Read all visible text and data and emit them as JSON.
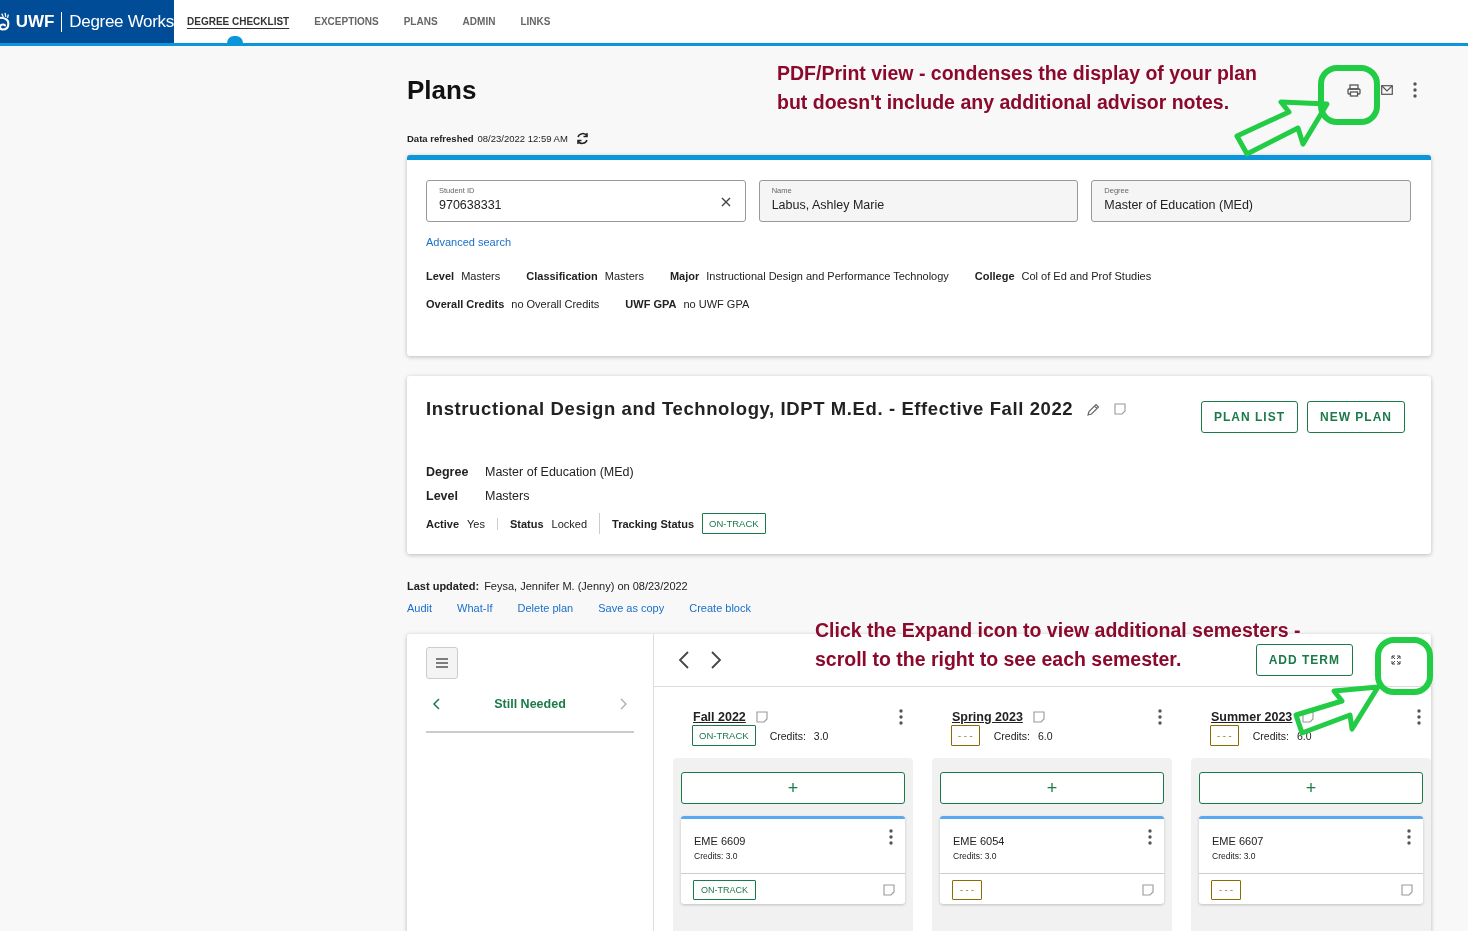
{
  "header": {
    "logo_short": "UWF",
    "logo_name": "Degree Works",
    "tabs": [
      {
        "label": "DEGREE CHECKLIST",
        "selected": true
      },
      {
        "label": "EXCEPTIONS",
        "selected": false
      },
      {
        "label": "PLANS",
        "selected": false
      },
      {
        "label": "ADMIN",
        "selected": false
      },
      {
        "label": "LINKS",
        "selected": false
      }
    ]
  },
  "page_title": "Plans",
  "refresh": {
    "label": "Data refreshed",
    "value": "08/23/2022 12:59 AM"
  },
  "annotations": [
    {
      "lines": [
        "PDF/Print view - condenses the display of your plan",
        "but doesn't include any additional advisor notes."
      ]
    },
    {
      "lines": [
        "Click the Expand icon to view additional semesters -",
        "scroll to the right to see each semester."
      ]
    }
  ],
  "student": {
    "fields": [
      {
        "label": "Student ID",
        "value": "970638331",
        "kind": "editable"
      },
      {
        "label": "Name",
        "value": "Labus, Ashley Marie",
        "kind": "readonly"
      },
      {
        "label": "Degree",
        "value": "Master of Education (MEd)",
        "kind": "readonly"
      }
    ],
    "advanced_search": "Advanced search",
    "facts": [
      [
        {
          "label": "Level",
          "value": "Masters"
        },
        {
          "label": "Classification",
          "value": "Masters"
        },
        {
          "label": "Major",
          "value": "Instructional Design and Performance Technology"
        },
        {
          "label": "College",
          "value": "Col of Ed and Prof Studies"
        }
      ],
      [
        {
          "label": "Overall Credits",
          "value": "no Overall Credits"
        },
        {
          "label": "UWF GPA",
          "value": "no UWF GPA"
        }
      ]
    ]
  },
  "plan": {
    "title": "Instructional Design and Technology, IDPT M.Ed. - Effective Fall 2022",
    "buttons": [
      "PLAN LIST",
      "NEW PLAN"
    ],
    "details": [
      {
        "label": "Degree",
        "value": "Master of Education (MEd)"
      },
      {
        "label": "Level",
        "value": "Masters"
      }
    ],
    "statuses": [
      {
        "label": "Active",
        "value": "Yes",
        "kind": "text"
      },
      {
        "label": "Status",
        "value": "Locked",
        "kind": "text"
      },
      {
        "label": "Tracking Status",
        "value": "ON-TRACK",
        "kind": "badge",
        "on_track": true
      }
    ]
  },
  "last_updated": {
    "label": "Last updated:",
    "value": "Feysa, Jennifer M. (Jenny) on 08/23/2022"
  },
  "actions": [
    "Audit",
    "What-If",
    "Delete plan",
    "Save as copy",
    "Create block"
  ],
  "planner": {
    "side_title": "Still Needed",
    "add_term": "ADD TERM",
    "terms": [
      {
        "name": "Fall 2022",
        "on_track": true,
        "badge": "ON-TRACK",
        "credits_label": "Credits:",
        "credits": "3.0",
        "add": "+",
        "course": {
          "code": "EME 6609",
          "credits": "Credits: 3.0",
          "on_track": true,
          "badge": "ON-TRACK"
        }
      },
      {
        "name": "Spring 2023",
        "on_track": false,
        "badge": "- - -",
        "credits_label": "Credits:",
        "credits": "6.0",
        "add": "+",
        "course": {
          "code": "EME 6054",
          "credits": "Credits: 3.0",
          "on_track": false,
          "badge": "- - -"
        }
      },
      {
        "name": "Summer 2023",
        "on_track": false,
        "badge": "- - -",
        "credits_label": "Credits:",
        "credits": "6.0",
        "add": "+",
        "course": {
          "code": "EME 6607",
          "credits": "Credits: 3.0",
          "on_track": false,
          "badge": "- - -"
        }
      }
    ]
  }
}
